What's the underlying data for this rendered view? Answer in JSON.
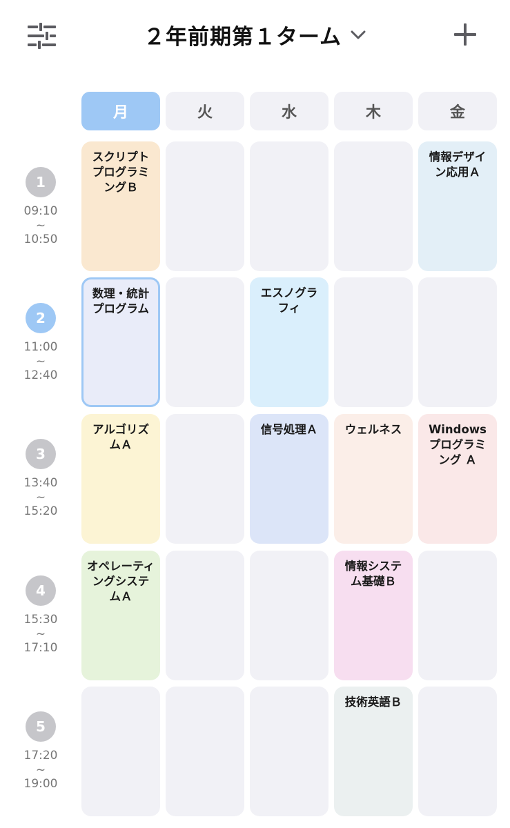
{
  "header": {
    "title": "２年前期第１ターム",
    "icons": {
      "filter": "sliders-icon",
      "dropdown": "chevron-down-icon",
      "add": "plus-icon"
    }
  },
  "days": [
    {
      "label": "月",
      "active": true
    },
    {
      "label": "火",
      "active": false
    },
    {
      "label": "水",
      "active": false
    },
    {
      "label": "木",
      "active": false
    },
    {
      "label": "金",
      "active": false
    }
  ],
  "periods": [
    {
      "num": "1",
      "start": "09:10",
      "sep": "~",
      "end": "10:50",
      "active": false
    },
    {
      "num": "2",
      "start": "11:00",
      "sep": "~",
      "end": "12:40",
      "active": true
    },
    {
      "num": "3",
      "start": "13:40",
      "sep": "~",
      "end": "15:20",
      "active": false
    },
    {
      "num": "4",
      "start": "15:30",
      "sep": "~",
      "end": "17:10",
      "active": false
    },
    {
      "num": "5",
      "start": "17:20",
      "sep": "~",
      "end": "19:00",
      "active": false
    }
  ],
  "grid": [
    [
      {
        "name": "スクリプトプログラミングＢ",
        "color": "#fae8d0"
      },
      {
        "name": "",
        "color": "#f1f1f6"
      },
      {
        "name": "",
        "color": "#f1f1f6"
      },
      {
        "name": "",
        "color": "#f1f1f6"
      },
      {
        "name": "情報デザイン応用Ａ",
        "color": "#e3eff7"
      }
    ],
    [
      {
        "name": "数理・統計プログラム",
        "color": "#e9ecf9",
        "selected": true
      },
      {
        "name": "",
        "color": "#f1f1f6"
      },
      {
        "name": "エスノグラフィ",
        "color": "#daeffc"
      },
      {
        "name": "",
        "color": "#f1f1f6"
      },
      {
        "name": "",
        "color": "#f1f1f6"
      }
    ],
    [
      {
        "name": "アルゴリズムＡ",
        "color": "#fcf4d4"
      },
      {
        "name": "",
        "color": "#f1f1f6"
      },
      {
        "name": "信号処理Ａ",
        "color": "#dce5f8"
      },
      {
        "name": "ウェルネス",
        "color": "#fbeee8"
      },
      {
        "name": "Windowsプログラミング Ａ",
        "color": "#fae8e8"
      }
    ],
    [
      {
        "name": "オペレーティングシステムＡ",
        "color": "#e6f3db"
      },
      {
        "name": "",
        "color": "#f1f1f6"
      },
      {
        "name": "",
        "color": "#f1f1f6"
      },
      {
        "name": "情報システム基礎Ｂ",
        "color": "#f7def0"
      },
      {
        "name": "",
        "color": "#f1f1f6"
      }
    ],
    [
      {
        "name": "",
        "color": "#f1f1f6"
      },
      {
        "name": "",
        "color": "#f1f1f6"
      },
      {
        "name": "",
        "color": "#f1f1f6"
      },
      {
        "name": "技術英語Ｂ",
        "color": "#ebf0f0"
      },
      {
        "name": "",
        "color": "#f1f1f6"
      }
    ]
  ],
  "colors": {
    "accent": "#9ec8f5",
    "empty": "#f1f1f6",
    "period_gray": "#c6c6ca"
  }
}
